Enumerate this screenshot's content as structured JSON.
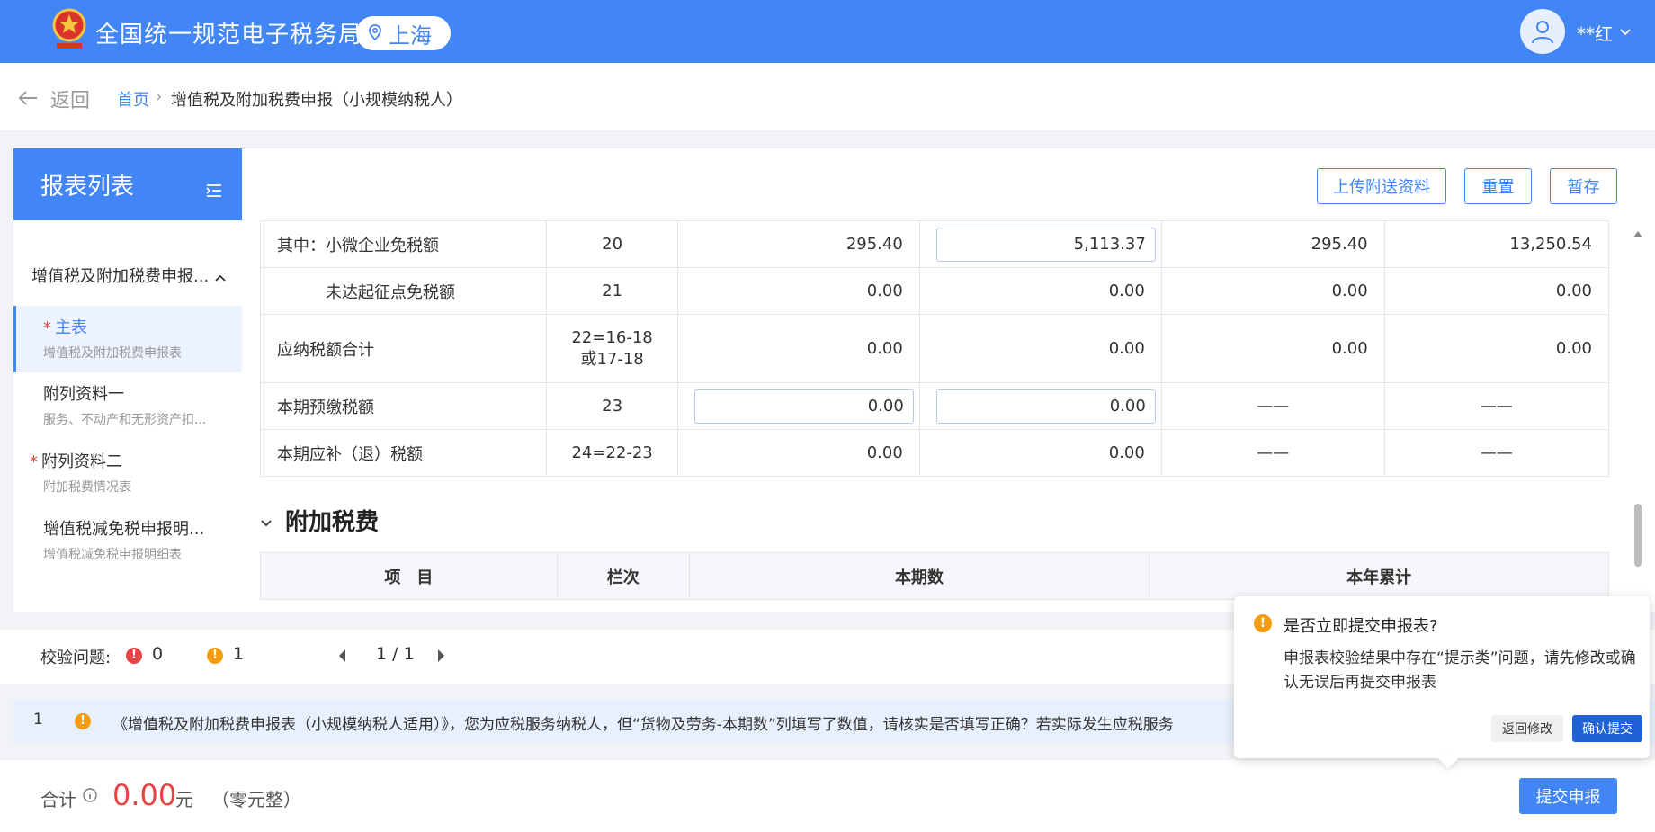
{
  "header": {
    "site_title": "全国统一规范电子税务局",
    "region": "上海",
    "user_name": "**红"
  },
  "breadcrumb": {
    "back_label": "返回",
    "home": "首页",
    "separator": "›",
    "current": "增值税及附加税费申报（小规模纳税人）"
  },
  "sidebar": {
    "title": "报表列表",
    "group_title": "增值税及附加税费申报...",
    "items": [
      {
        "title": "主表",
        "sub": "增值税及附加税费申报表",
        "required": true
      },
      {
        "title": "附列资料一",
        "sub": "服务、不动产和无形资产扣...",
        "required": false
      },
      {
        "title": "附列资料二",
        "sub": "附加税费情况表",
        "required": true
      },
      {
        "title": "增值税减免税申报明...",
        "sub": "增值税减免税申报明细表",
        "required": false
      }
    ]
  },
  "toolbar": {
    "upload_label": "上传附送资料",
    "reset_label": "重置",
    "save_label": "暂存"
  },
  "main_table": {
    "rows": [
      {
        "label": "其中：小微企业免税额",
        "col": "20",
        "v1": "295.40",
        "v2": "5,113.37",
        "v3": "295.40",
        "v4": "13,250.54"
      },
      {
        "label": "未达起征点免税额",
        "col": "21",
        "v1": "0.00",
        "v2": "0.00",
        "v3": "0.00",
        "v4": "0.00"
      },
      {
        "label": "应纳税额合计",
        "col": "22=16-18或17-18",
        "v1": "0.00",
        "v2": "0.00",
        "v3": "0.00",
        "v4": "0.00"
      },
      {
        "label": "本期预缴税额",
        "col": "23",
        "v1": "0.00",
        "v2": "0.00",
        "v3": "——",
        "v4": "——"
      },
      {
        "label": "本期应补（退）税额",
        "col": "24=22-23",
        "v1": "0.00",
        "v2": "0.00",
        "v3": "——",
        "v4": "——"
      }
    ]
  },
  "surtax": {
    "section_title": "附加税费",
    "headers": [
      "项　目",
      "栏次",
      "本期数",
      "本年累计"
    ]
  },
  "validation": {
    "label": "校验问题:",
    "error_count": "0",
    "warning_count": "1",
    "page": "1 / 1",
    "message_index": "1",
    "message": "《增值税及附加税费申报表（小规模纳税人适用）》，您为应税服务纳税人，但“货物及劳务-本期数”列填写了数值，请核实是否填写正确？若实际发生应税服务"
  },
  "footer": {
    "total_label": "合计",
    "total_amount": "0.00",
    "unit": "元",
    "amount_words": "（零元整）",
    "submit_label": "提交申报"
  },
  "popover": {
    "title": "是否立即提交申报表?",
    "body": "申报表校验结果中存在“提示类”问题，请先修改或确认无误后再提交申报表",
    "cancel_label": "返回修改",
    "confirm_label": "确认提交"
  },
  "colors": {
    "brand": "#4285f4",
    "error": "#e64545",
    "warning": "#f39c12"
  }
}
